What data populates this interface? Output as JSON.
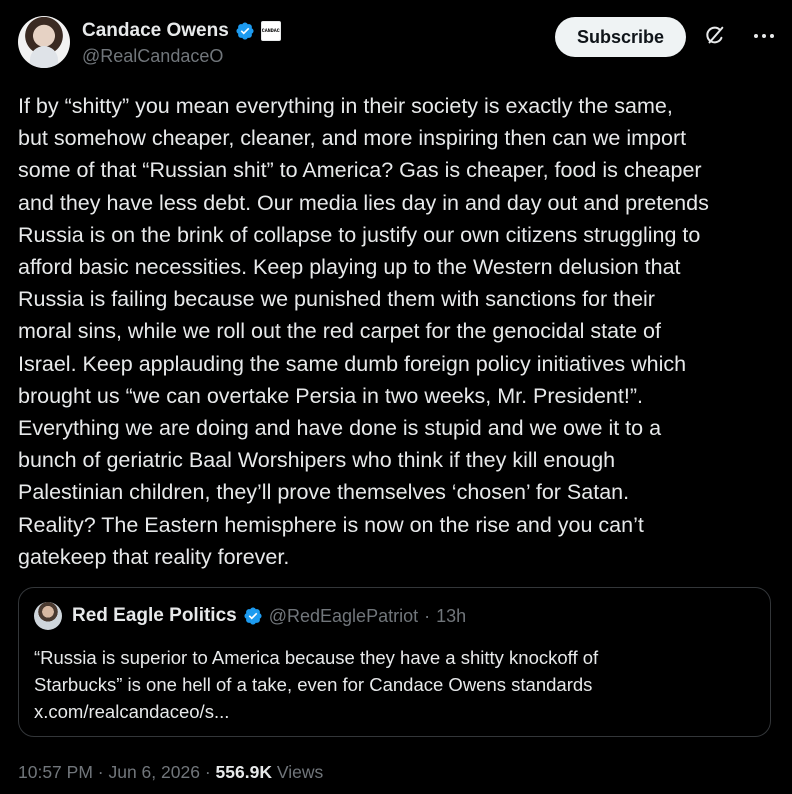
{
  "author": {
    "display_name": "Candace Owens",
    "handle": "@RealCandaceO",
    "affiliate_badge_text": "CANDACE"
  },
  "actions": {
    "subscribe_label": "Subscribe"
  },
  "tweet": {
    "text": "If by “shitty” you mean everything in their society is exactly the same,\nbut somehow cheaper, cleaner, and more inspiring then can we import\nsome of that “Russian shit” to America? Gas is cheaper, food is cheaper\nand they have less debt. Our media lies day in and day out and pretends\nRussia is on the brink of collapse to justify our own citizens struggling to\nafford basic necessities. Keep playing up to the Western delusion that\nRussia is failing because we punished them with sanctions for their\nmoral sins, while we roll out the red carpet for the genocidal state of\nIsrael. Keep applauding the same dumb foreign policy initiatives which\nbrought us “we can overtake Persia in two weeks, Mr. President!”.\nEverything we are doing and have done is stupid and we owe it to a\nbunch of geriatric Baal Worshipers who think if they kill enough\nPalestinian children, they’ll prove themselves ‘chosen’ for Satan.\nReality? The Eastern hemisphere is now on the rise and you can’t\ngatekeep that reality forever."
  },
  "quoted": {
    "display_name": "Red Eagle Politics",
    "handle": "@RedEaglePatriot",
    "separator": "·",
    "time": "13h",
    "text": "“Russia is superior to America because they have a shitty knockoff of\nStarbucks” is one hell of a take, even for Candace Owens standards\nx.com/realcandaceo/s..."
  },
  "meta": {
    "time": "10:57 PM",
    "separator": "·",
    "date": "Jun 6, 2026",
    "views_count": "556.9K",
    "views_label": "Views"
  },
  "icons": {
    "verified": "verified-badge-icon",
    "grok": "grok-icon",
    "more": "more-icon"
  },
  "colors": {
    "background": "#000000",
    "text": "#e7e9ea",
    "muted": "#71767b",
    "verified_blue": "#1d9bf0",
    "border": "#333639",
    "subscribe_bg": "#eff3f4"
  }
}
